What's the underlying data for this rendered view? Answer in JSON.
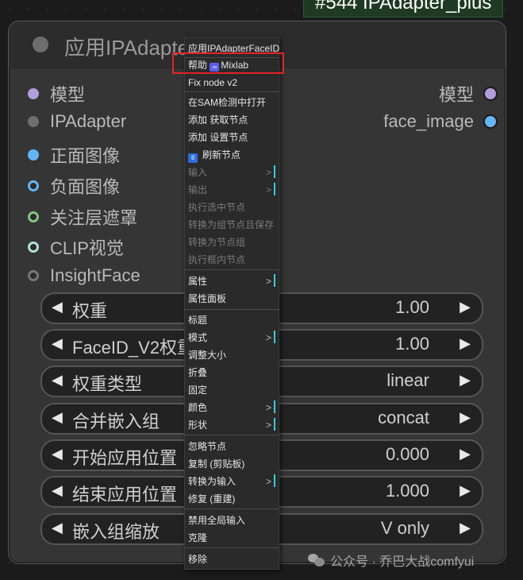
{
  "node_badge": "#544 IPAdapter_plus",
  "node": {
    "title": "应用IPAdapterFaceID",
    "inputs": [
      {
        "label": "模型",
        "color": "#b39ddb"
      },
      {
        "label": "IPAdapter",
        "color": "#777777"
      },
      {
        "label": "正面图像",
        "color": "#64b5f6"
      },
      {
        "label": "负面图像",
        "color": "#64b5f6"
      },
      {
        "label": "关注层遮罩",
        "color": "#81c784"
      },
      {
        "label": "CLIP视觉",
        "color": "#b2dfdb"
      },
      {
        "label": "InsightFace",
        "color": "#777777"
      }
    ],
    "outputs": [
      {
        "label": "模型",
        "color": "#b39ddb"
      },
      {
        "label": "face_image",
        "color": "#64b5f6"
      }
    ],
    "widgets": [
      {
        "label": "权重",
        "value": "1.00"
      },
      {
        "label": "FaceID_V2权重",
        "value": "1.00"
      },
      {
        "label": "权重类型",
        "value": "linear"
      },
      {
        "label": "合并嵌入组",
        "value": "concat"
      },
      {
        "label": "开始应用位置",
        "value": "0.000"
      },
      {
        "label": "结束应用位置",
        "value": "1.000"
      },
      {
        "label": "嵌入组缩放",
        "value": "V only"
      }
    ]
  },
  "context_menu": {
    "header": "应用IPAdapterFaceID",
    "help": "帮助",
    "help_badge": "∞",
    "help_target": "Mixlab",
    "fix_node": "Fix node v2",
    "open_in_sam": "在SAM检测中打开",
    "add_get_node": "添加 获取节点",
    "add_set_node": "添加 设置节点",
    "refresh_icon": "tl",
    "refresh_nodes": "刷新节点",
    "inputs": "输入",
    "outputs": "输出",
    "execute_selected": "执行选中节点",
    "convert_group_save": "转换为组节点且保存",
    "convert_group": "转换为节点组",
    "execute_in_frame": "执行框内节点",
    "properties": "属性",
    "properties_panel": "属性面板",
    "title": "标题",
    "mode": "模式",
    "resize": "调整大小",
    "collapse": "折叠",
    "pin": "固定",
    "colors": "颜色",
    "shapes": "形状",
    "bypass": "忽略节点",
    "copy": "复制 (剪贴板)",
    "convert_to_input": "转换为输入",
    "fix_recreate": "修复 (重建)",
    "disable_global_input": "禁用全局输入",
    "clone": "克隆",
    "remove": "移除",
    "submenu_arrow": ">"
  },
  "watermark": "公众号 · 乔巴大战comfyui"
}
